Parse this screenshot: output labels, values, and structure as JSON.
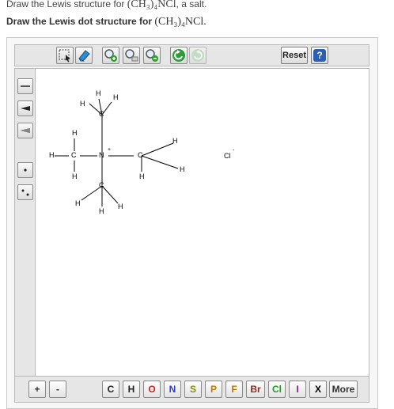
{
  "question": {
    "line1_text": "Draw the Lewis structure for",
    "line1_formula": "(CH₃)₄NCl",
    "line1_suffix": ", a salt.",
    "line2_text": "Draw the Lewis dot structure for",
    "line2_formula": "(CH₃)₄NCl."
  },
  "toolbar": {
    "tools": [
      {
        "name": "select-lasso-tool",
        "icon": "lasso-select-icon"
      },
      {
        "name": "eraser-tool",
        "icon": "eraser-icon"
      },
      {
        "name": "zoom-in-tool",
        "icon": "magnifier-plus-icon"
      },
      {
        "name": "zoom-reset-tool",
        "icon": "magnifier-icon"
      },
      {
        "name": "zoom-out-tool",
        "icon": "magnifier-minus-icon"
      },
      {
        "name": "undo-tool",
        "icon": "undo-icon"
      },
      {
        "name": "redo-tool",
        "icon": "redo-icon"
      }
    ],
    "reset_label": "Reset",
    "help_label": "?"
  },
  "left_tools": [
    {
      "name": "single-bond-tool",
      "icon": "single-bond-icon"
    },
    {
      "name": "wedge-bond-tool",
      "icon": "wedge-bond-icon"
    },
    {
      "name": "hash-bond-tool",
      "icon": "hash-bond-icon"
    },
    {
      "name": "radical-tool",
      "icon": "single-dot-icon"
    },
    {
      "name": "lone-pair-tool",
      "icon": "dot-pair-icon"
    }
  ],
  "bottom": {
    "charge_plus": "+",
    "charge_minus": "-",
    "elements": [
      "C",
      "H",
      "O",
      "N",
      "S",
      "P",
      "F",
      "Br",
      "Cl",
      "I",
      "X"
    ],
    "element_colors": {
      "C": "#222222",
      "H": "#222222",
      "O": "#d42020",
      "N": "#2a3fcf",
      "S": "#8a8a00",
      "P": "#c07a00",
      "F": "#c07a00",
      "Br": "#8b2a1a",
      "Cl": "#1e9c1e",
      "I": "#8a1a9c",
      "X": "#000000"
    },
    "more_label": "More"
  },
  "molecule": {
    "center_atom": "N",
    "center_charge": "+",
    "counter_ion": "Cl",
    "counter_charge": "-",
    "carbon_label": "C",
    "hydrogen_label": "H"
  }
}
